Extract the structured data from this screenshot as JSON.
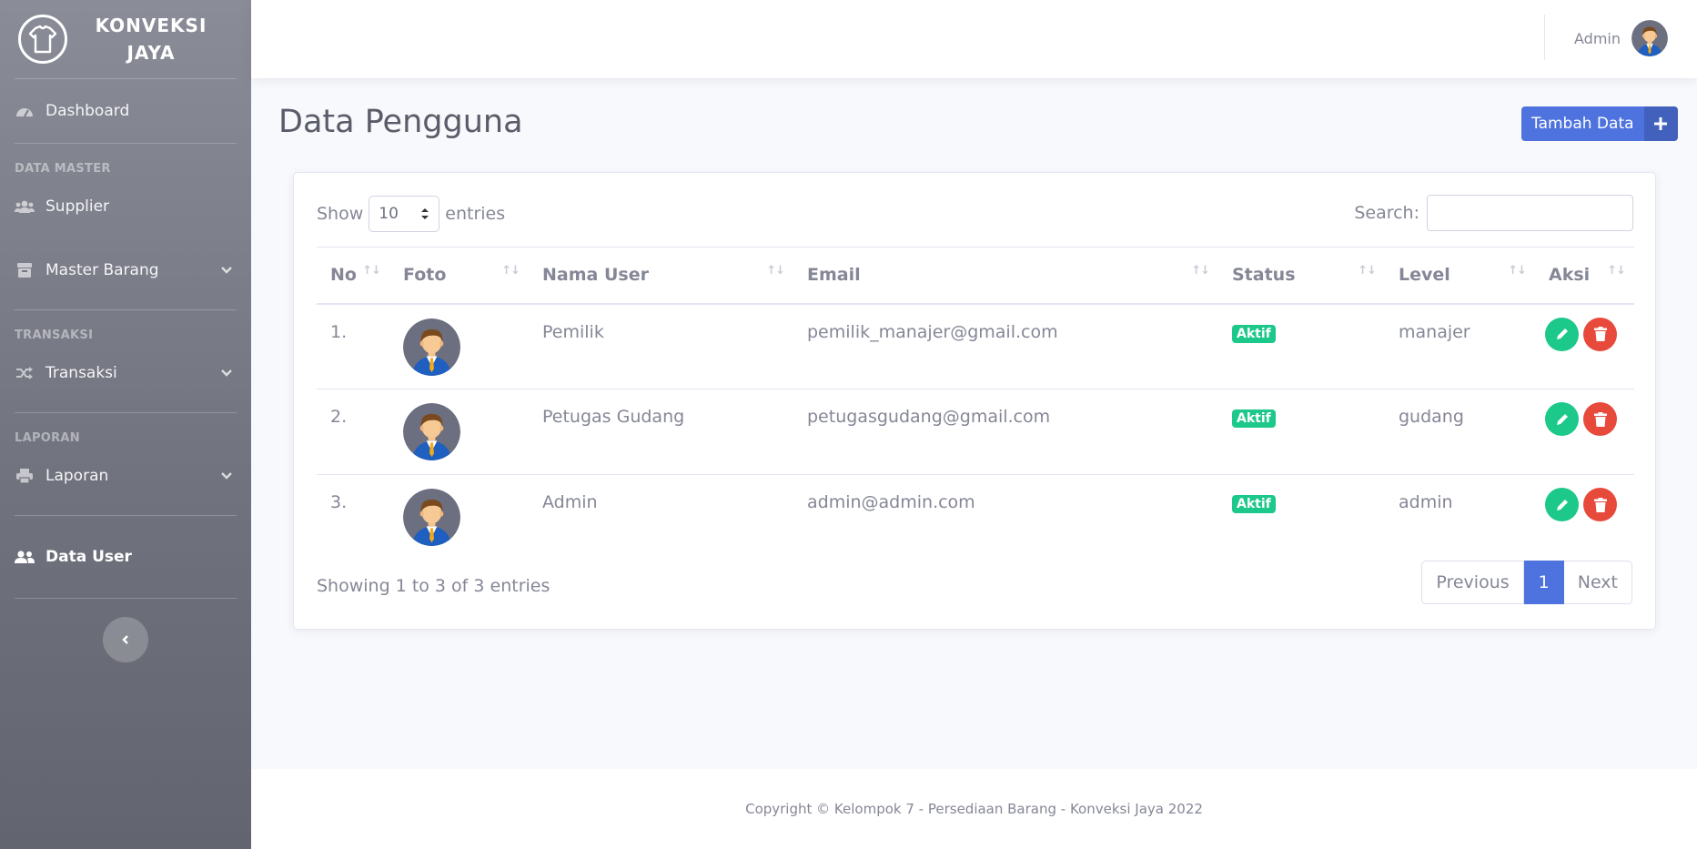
{
  "brand": {
    "name": "KONVEKSI JAYA"
  },
  "sidebar": {
    "dashboard": "Dashboard",
    "heading_master": "DATA MASTER",
    "supplier": "Supplier",
    "master_barang": "Master Barang",
    "heading_transaksi": "TRANSAKSI",
    "transaksi": "Transaksi",
    "heading_laporan": "LAPORAN",
    "laporan": "Laporan",
    "data_user": "Data User"
  },
  "topbar": {
    "user_name": "Admin"
  },
  "page": {
    "title": "Data Pengguna",
    "add_button": "Tambah Data"
  },
  "table_controls": {
    "show_label": "Show",
    "page_length": "10",
    "entries_label": "entries",
    "search_label": "Search:",
    "search_value": ""
  },
  "table": {
    "columns": [
      "No",
      "Foto",
      "Nama User",
      "Email",
      "Status",
      "Level",
      "Aksi"
    ],
    "rows": [
      {
        "no": "1.",
        "name": "Pemilik",
        "email": "pemilik_manajer@gmail.com",
        "status": "Aktif",
        "level": "manajer"
      },
      {
        "no": "2.",
        "name": "Petugas Gudang",
        "email": "petugasgudang@gmail.com",
        "status": "Aktif",
        "level": "gudang"
      },
      {
        "no": "3.",
        "name": "Admin",
        "email": "admin@admin.com",
        "status": "Aktif",
        "level": "admin"
      }
    ]
  },
  "pagination": {
    "info": "Showing 1 to 3 of 3 entries",
    "previous": "Previous",
    "current": "1",
    "next": "Next"
  },
  "footer": {
    "text": "Copyright © Kelompok 7 - Persediaan Barang - Konveksi Jaya 2022"
  },
  "colors": {
    "primary": "#4e73df",
    "success": "#1cc88a",
    "danger": "#e74a3b",
    "sidebar": "#6f717d"
  }
}
